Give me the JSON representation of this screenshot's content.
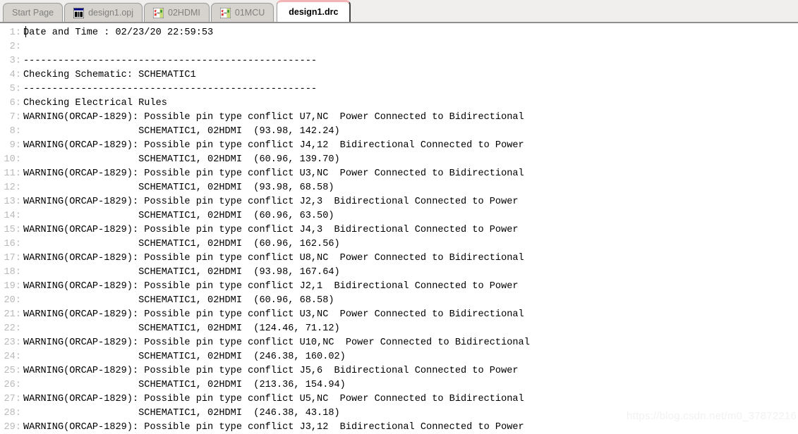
{
  "tabs": [
    {
      "label": "Start Page",
      "icon": "",
      "active": false
    },
    {
      "label": "design1.opj",
      "icon": "project-icon",
      "active": false
    },
    {
      "label": "02HDMI",
      "icon": "schematic-icon",
      "active": false
    },
    {
      "label": "01MCU",
      "icon": "schematic-icon",
      "active": false
    },
    {
      "label": "design1.drc",
      "icon": "",
      "active": true
    }
  ],
  "editor": {
    "lines": [
      {
        "num": "1:",
        "text": "Date and Time : 02/23/20 22:59:53"
      },
      {
        "num": "2:",
        "text": ""
      },
      {
        "num": "3:",
        "text": "---------------------------------------------------"
      },
      {
        "num": "4:",
        "text": "Checking Schematic: SCHEMATIC1"
      },
      {
        "num": "5:",
        "text": "---------------------------------------------------"
      },
      {
        "num": "6:",
        "text": "Checking Electrical Rules"
      },
      {
        "num": "7:",
        "text": "WARNING(ORCAP-1829): Possible pin type conflict U7,NC  Power Connected to Bidirectional"
      },
      {
        "num": "8:",
        "text": "                    SCHEMATIC1, 02HDMI  (93.98, 142.24)"
      },
      {
        "num": "9:",
        "text": "WARNING(ORCAP-1829): Possible pin type conflict J4,12  Bidirectional Connected to Power"
      },
      {
        "num": "10:",
        "text": "                    SCHEMATIC1, 02HDMI  (60.96, 139.70)"
      },
      {
        "num": "11:",
        "text": "WARNING(ORCAP-1829): Possible pin type conflict U3,NC  Power Connected to Bidirectional"
      },
      {
        "num": "12:",
        "text": "                    SCHEMATIC1, 02HDMI  (93.98, 68.58)"
      },
      {
        "num": "13:",
        "text": "WARNING(ORCAP-1829): Possible pin type conflict J2,3  Bidirectional Connected to Power"
      },
      {
        "num": "14:",
        "text": "                    SCHEMATIC1, 02HDMI  (60.96, 63.50)"
      },
      {
        "num": "15:",
        "text": "WARNING(ORCAP-1829): Possible pin type conflict J4,3  Bidirectional Connected to Power"
      },
      {
        "num": "16:",
        "text": "                    SCHEMATIC1, 02HDMI  (60.96, 162.56)"
      },
      {
        "num": "17:",
        "text": "WARNING(ORCAP-1829): Possible pin type conflict U8,NC  Power Connected to Bidirectional"
      },
      {
        "num": "18:",
        "text": "                    SCHEMATIC1, 02HDMI  (93.98, 167.64)"
      },
      {
        "num": "19:",
        "text": "WARNING(ORCAP-1829): Possible pin type conflict J2,1  Bidirectional Connected to Power"
      },
      {
        "num": "20:",
        "text": "                    SCHEMATIC1, 02HDMI  (60.96, 68.58)"
      },
      {
        "num": "21:",
        "text": "WARNING(ORCAP-1829): Possible pin type conflict U3,NC  Power Connected to Bidirectional"
      },
      {
        "num": "22:",
        "text": "                    SCHEMATIC1, 02HDMI  (124.46, 71.12)"
      },
      {
        "num": "23:",
        "text": "WARNING(ORCAP-1829): Possible pin type conflict U10,NC  Power Connected to Bidirectional"
      },
      {
        "num": "24:",
        "text": "                    SCHEMATIC1, 02HDMI  (246.38, 160.02)"
      },
      {
        "num": "25:",
        "text": "WARNING(ORCAP-1829): Possible pin type conflict J5,6  Bidirectional Connected to Power"
      },
      {
        "num": "26:",
        "text": "                    SCHEMATIC1, 02HDMI  (213.36, 154.94)"
      },
      {
        "num": "27:",
        "text": "WARNING(ORCAP-1829): Possible pin type conflict U5,NC  Power Connected to Bidirectional"
      },
      {
        "num": "28:",
        "text": "                    SCHEMATIC1, 02HDMI  (246.38, 43.18)"
      },
      {
        "num": "29:",
        "text": "WARNING(ORCAP-1829): Possible pin type conflict J3,12  Bidirectional Connected to Power"
      }
    ]
  },
  "watermark": {
    "text": "https://blog.csdn.net/m0_37872216"
  },
  "colors": {
    "tabbar_bg": "#f0efee",
    "inactive_tab_bg": "#d6d3ce",
    "active_tab_accent": "#f2b4b4",
    "gutter_text": "#b9b9b9",
    "code_text": "#000000"
  }
}
